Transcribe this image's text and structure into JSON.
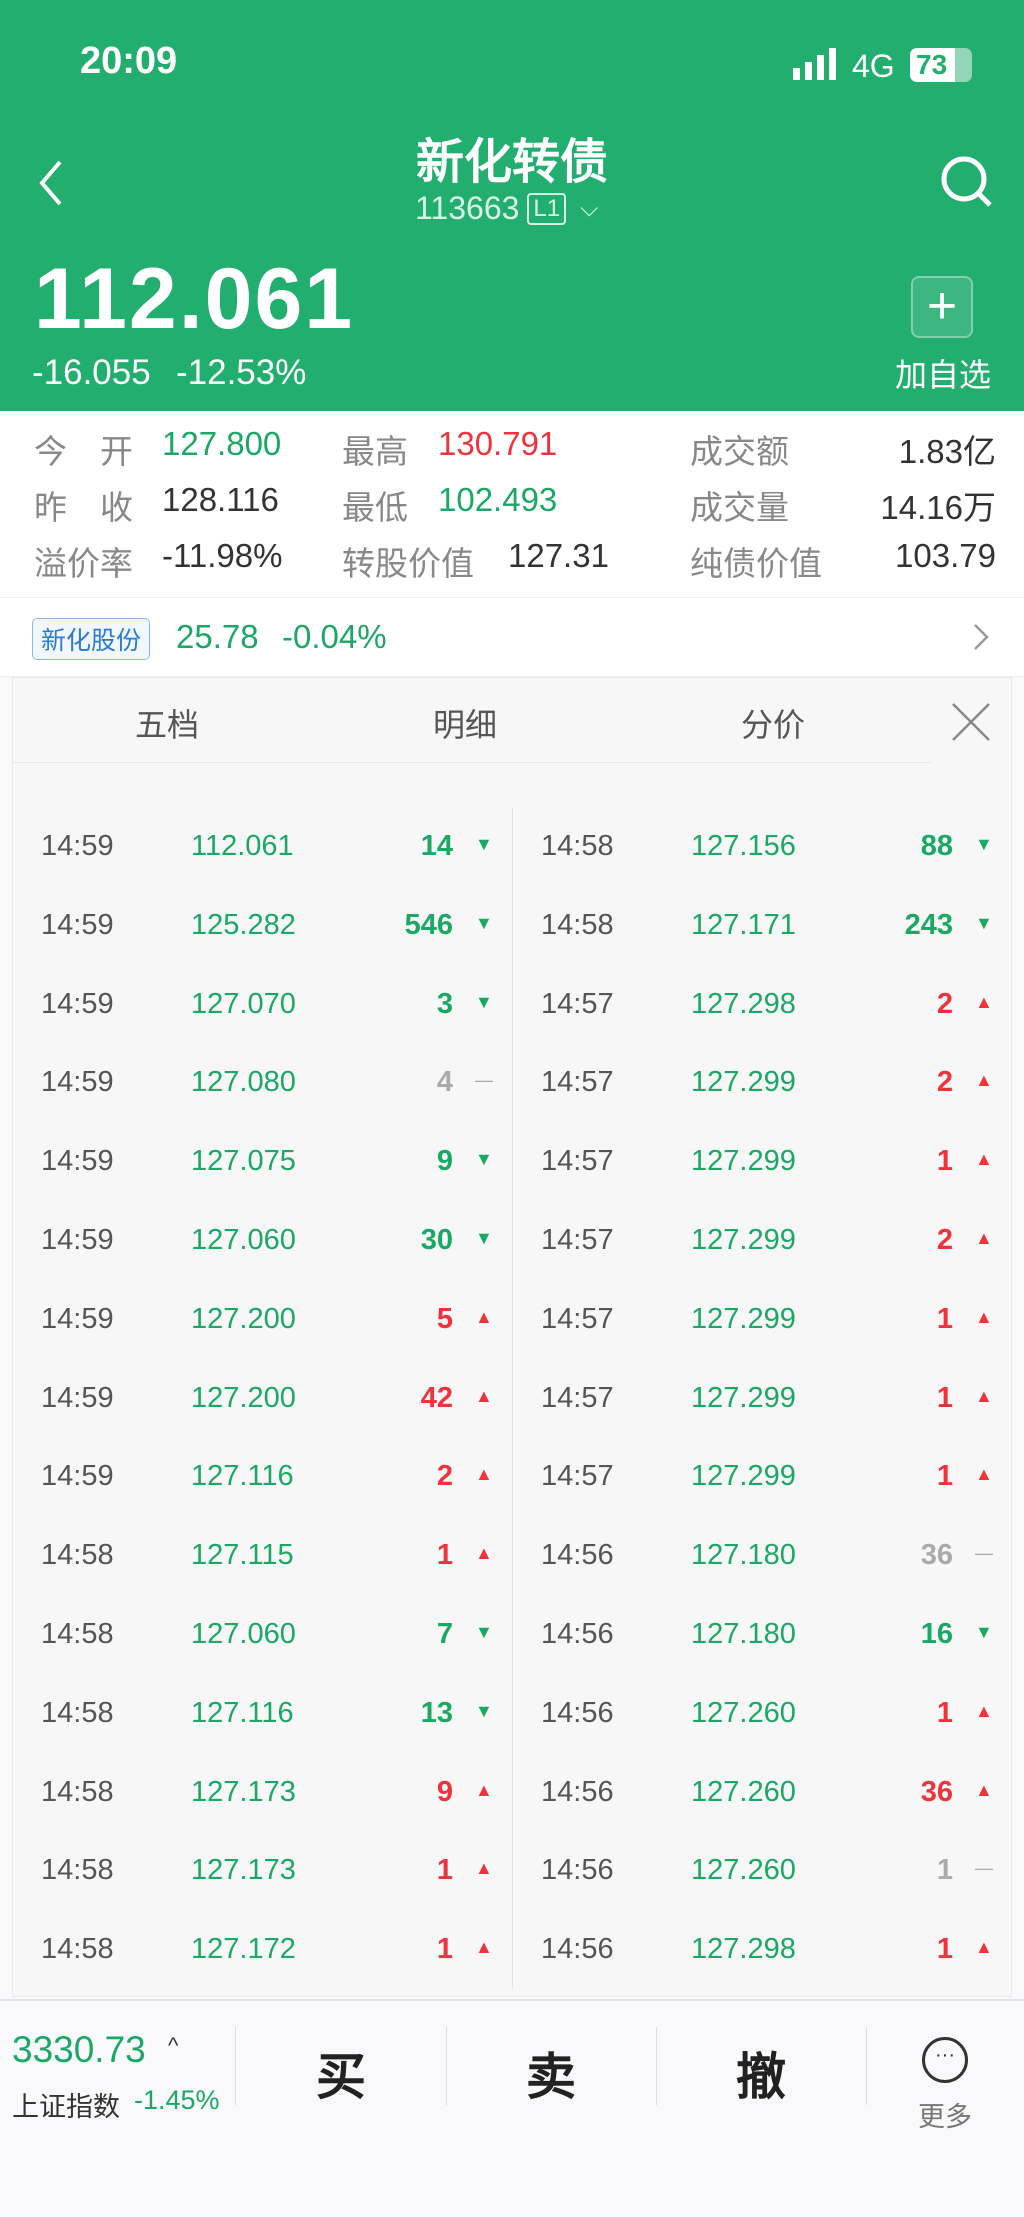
{
  "status": {
    "time": "20:09",
    "network": "4G",
    "battery": "73"
  },
  "header": {
    "title": "新化转债",
    "code": "113663",
    "level": "L1",
    "price": "112.061",
    "change": "-16.055",
    "change_pct": "-12.53%",
    "add_watch": "加自选"
  },
  "stats": [
    {
      "label": "今　开",
      "value": "127.800",
      "color": "g"
    },
    {
      "label": "最高",
      "value": "130.791",
      "color": "r"
    },
    {
      "label": "成交额",
      "value": "1.83亿",
      "color": ""
    },
    {
      "label": "昨　收",
      "value": "128.116",
      "color": ""
    },
    {
      "label": "最低",
      "value": "102.493",
      "color": "g"
    },
    {
      "label": "成交量",
      "value": "14.16万",
      "color": ""
    },
    {
      "label": "溢价率",
      "value": "-11.98%",
      "color": ""
    },
    {
      "label": "转股价值",
      "value": "127.31",
      "color": ""
    },
    {
      "label": "纯债价值",
      "value": "103.79",
      "color": ""
    }
  ],
  "stock": {
    "name": "新化股份",
    "price": "25.78",
    "change_pct": "-0.04%"
  },
  "tabs": [
    "五档",
    "明细",
    "分价"
  ],
  "active_tab": 1,
  "trades_left": [
    [
      "14:59",
      "112.061",
      "14",
      "down"
    ],
    [
      "14:59",
      "125.282",
      "546",
      "down"
    ],
    [
      "14:59",
      "127.070",
      "3",
      "down"
    ],
    [
      "14:59",
      "127.080",
      "4",
      "flat"
    ],
    [
      "14:59",
      "127.075",
      "9",
      "down"
    ],
    [
      "14:59",
      "127.060",
      "30",
      "down"
    ],
    [
      "14:59",
      "127.200",
      "5",
      "up"
    ],
    [
      "14:59",
      "127.200",
      "42",
      "up"
    ],
    [
      "14:59",
      "127.116",
      "2",
      "up"
    ],
    [
      "14:58",
      "127.115",
      "1",
      "up"
    ],
    [
      "14:58",
      "127.060",
      "7",
      "down"
    ],
    [
      "14:58",
      "127.116",
      "13",
      "down"
    ],
    [
      "14:58",
      "127.173",
      "9",
      "up"
    ],
    [
      "14:58",
      "127.173",
      "1",
      "up"
    ],
    [
      "14:58",
      "127.172",
      "1",
      "up"
    ]
  ],
  "trades_right": [
    [
      "14:58",
      "127.156",
      "88",
      "down"
    ],
    [
      "14:58",
      "127.171",
      "243",
      "down"
    ],
    [
      "14:57",
      "127.298",
      "2",
      "up"
    ],
    [
      "14:57",
      "127.299",
      "2",
      "up"
    ],
    [
      "14:57",
      "127.299",
      "1",
      "up"
    ],
    [
      "14:57",
      "127.299",
      "2",
      "up"
    ],
    [
      "14:57",
      "127.299",
      "1",
      "up"
    ],
    [
      "14:57",
      "127.299",
      "1",
      "up"
    ],
    [
      "14:57",
      "127.299",
      "1",
      "up"
    ],
    [
      "14:56",
      "127.180",
      "36",
      "flat"
    ],
    [
      "14:56",
      "127.180",
      "16",
      "down"
    ],
    [
      "14:56",
      "127.260",
      "1",
      "up"
    ],
    [
      "14:56",
      "127.260",
      "36",
      "up"
    ],
    [
      "14:56",
      "127.260",
      "1",
      "flat"
    ],
    [
      "14:56",
      "127.298",
      "1",
      "up"
    ]
  ],
  "bottom": {
    "index_value": "3330.73",
    "index_name": "上证指数",
    "index_pct": "-1.45%",
    "buy": "买",
    "sell": "卖",
    "cancel": "撤",
    "more": "更多"
  }
}
